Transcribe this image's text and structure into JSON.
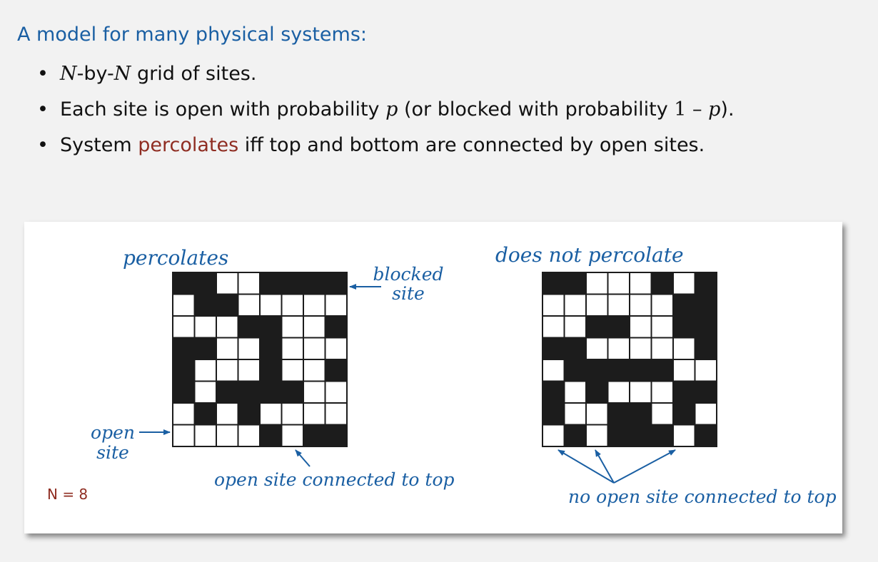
{
  "heading": "A model for many physical systems:",
  "bullets": {
    "b1": {
      "n1": "N",
      "mid": "-by-",
      "n2": "N",
      "rest": " grid of sites."
    },
    "b2": {
      "pre": "Each site is open with probability ",
      "p": "p",
      "mid": " (or blocked with probability ",
      "one": "1 – ",
      "p2": "p",
      "end": ")."
    },
    "b3": {
      "pre": "System ",
      "hl": "percolates",
      "post": " iff top and bottom are connected by open sites."
    }
  },
  "colors": {
    "heading": "#1a5fa3",
    "highlight": "#8f2d22",
    "blocked": "#1c1c1c",
    "open": "#ffffff",
    "annotation": "#1a5fa3"
  },
  "diagram": {
    "left_title": "percolates",
    "right_title": "does not percolate",
    "blocked_label": [
      "blocked",
      "site"
    ],
    "open_label": [
      "open",
      "site"
    ],
    "connected_label": "open site connected to top",
    "not_connected_label": "no open site connected to top",
    "n_label": "N = 8",
    "left_grid": [
      "11001111",
      "01100000",
      "00011001",
      "11001000",
      "10001001",
      "10111100",
      "01010000",
      "00001011"
    ],
    "right_grid": [
      "11000101",
      "00000011",
      "00110011",
      "11000001",
      "01111100",
      "10100011",
      "10011010",
      "01011101"
    ]
  }
}
